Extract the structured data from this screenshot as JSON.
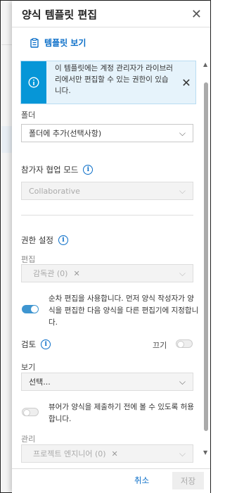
{
  "dialog": {
    "title": "양식 템플릿 편집",
    "view_template_label": "템플릿 보기"
  },
  "banner": {
    "message": "이 템플릿에는 계정 관리자가 라이브러리에서만 편집할 수 있는 권한이 있습니다.",
    "accent_color": "#0696d7"
  },
  "folder": {
    "label": "폴더",
    "placeholder": "폴더에 추가(선택사항)"
  },
  "collab": {
    "label": "참가자 협업 모드",
    "value": "Collaborative"
  },
  "permissions": {
    "title": "권한 설정",
    "edit": {
      "label": "편집",
      "chip": "감독관 (0)"
    },
    "sequential": {
      "enabled": true,
      "text": "순차 편집을 사용합니다. 먼저 양식 작성자가 양식을 편집한 다음 양식을 다른 편집기에 지정합니다."
    },
    "review": {
      "label": "검토",
      "toggle_label": "끄기",
      "enabled": false
    },
    "view": {
      "label": "보기",
      "placeholder": "선택..."
    },
    "viewer_before_submit": {
      "enabled": false,
      "text": "뷰어가 양식을 제출하기 전에 볼 수 있도록 허용합니다."
    },
    "manage": {
      "label": "관리",
      "chip": "프로젝트 엔지니어 (0)"
    }
  },
  "footer": {
    "cancel_label": "취소",
    "save_label": "저장"
  },
  "icons": {
    "close": "close-icon",
    "clipboard": "clipboard-icon",
    "info": "info-icon",
    "chevron": "chevron-down-icon"
  },
  "colors": {
    "link": "#0a6ec8",
    "toggle_on": "#3e95d0"
  }
}
